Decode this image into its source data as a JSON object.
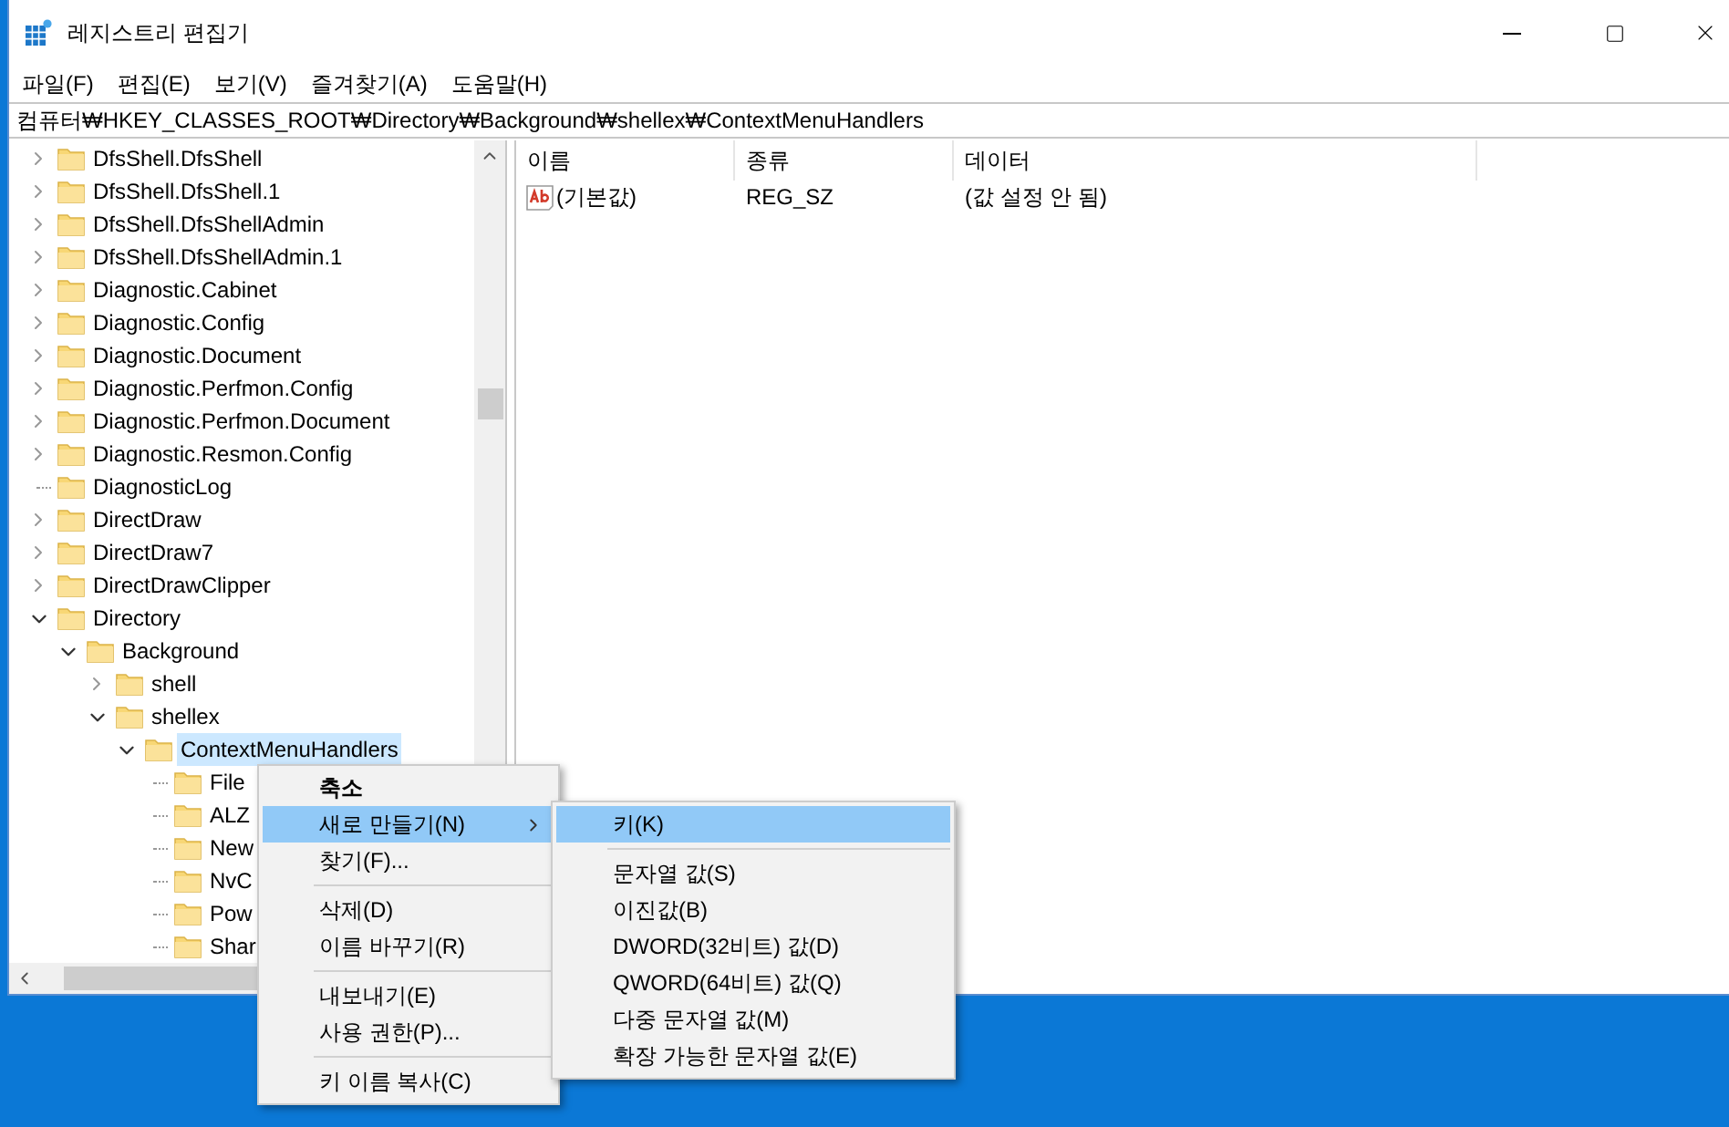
{
  "window": {
    "title": "레지스트리 편집기"
  },
  "menu_bar": [
    "파일(F)",
    "편집(E)",
    "보기(V)",
    "즐겨찾기(A)",
    "도움말(H)"
  ],
  "address": "컴퓨터₩HKEY_CLASSES_ROOT₩Directory₩Background₩shellex₩ContextMenuHandlers",
  "tree": [
    {
      "label": "DfsShell.DfsShell",
      "kind": "branch",
      "expanded": false,
      "selected": false
    },
    {
      "label": "DfsShell.DfsShell.1",
      "kind": "branch",
      "expanded": false,
      "selected": false
    },
    {
      "label": "DfsShell.DfsShellAdmin",
      "kind": "branch",
      "expanded": false,
      "selected": false
    },
    {
      "label": "DfsShell.DfsShellAdmin.1",
      "kind": "branch",
      "expanded": false,
      "selected": false
    },
    {
      "label": "Diagnostic.Cabinet",
      "kind": "branch",
      "expanded": false,
      "selected": false
    },
    {
      "label": "Diagnostic.Config",
      "kind": "branch",
      "expanded": false,
      "selected": false
    },
    {
      "label": "Diagnostic.Document",
      "kind": "branch",
      "expanded": false,
      "selected": false
    },
    {
      "label": "Diagnostic.Perfmon.Config",
      "kind": "branch",
      "expanded": false,
      "selected": false
    },
    {
      "label": "Diagnostic.Perfmon.Document",
      "kind": "branch",
      "expanded": false,
      "selected": false
    },
    {
      "label": "Diagnostic.Resmon.Config",
      "kind": "branch",
      "expanded": false,
      "selected": false
    },
    {
      "label": "DiagnosticLog",
      "kind": "leaf",
      "selected": false
    },
    {
      "label": "DirectDraw",
      "kind": "branch",
      "expanded": false,
      "selected": false
    },
    {
      "label": "DirectDraw7",
      "kind": "branch",
      "expanded": false,
      "selected": false
    },
    {
      "label": "DirectDrawClipper",
      "kind": "branch",
      "expanded": false,
      "selected": false
    },
    {
      "label": "Directory",
      "kind": "branch",
      "expanded": true,
      "selected": false,
      "children": [
        {
          "label": "Background",
          "kind": "branch",
          "expanded": true,
          "selected": false,
          "children": [
            {
              "label": "shell",
              "kind": "branch",
              "expanded": false,
              "selected": false
            },
            {
              "label": "shellex",
              "kind": "branch",
              "expanded": true,
              "selected": false,
              "children": [
                {
                  "label": "ContextMenuHandlers",
                  "kind": "branch",
                  "expanded": true,
                  "selected": true,
                  "children": [
                    {
                      "label": "File",
                      "kind": "leaf",
                      "selected": false
                    },
                    {
                      "label": "ALZ",
                      "kind": "leaf",
                      "selected": false
                    },
                    {
                      "label": "New",
                      "kind": "leaf",
                      "selected": false
                    },
                    {
                      "label": "NvC",
                      "kind": "leaf",
                      "selected": false
                    },
                    {
                      "label": "Pow",
                      "kind": "leaf",
                      "selected": false
                    },
                    {
                      "label": "Shar",
                      "kind": "leaf",
                      "selected": false
                    }
                  ]
                }
              ]
            }
          ]
        }
      ]
    }
  ],
  "list": {
    "columns": [
      "이름",
      "종류",
      "데이터"
    ],
    "rows": [
      {
        "name": "(기본값)",
        "type": "REG_SZ",
        "data": "(값 설정 안 됨)"
      }
    ]
  },
  "context_menu": [
    {
      "kind": "item",
      "label": "축소",
      "bold": true,
      "selected": false,
      "has_submenu": false
    },
    {
      "kind": "item",
      "label": "새로 만들기(N)",
      "bold": false,
      "selected": true,
      "has_submenu": true
    },
    {
      "kind": "item",
      "label": "찾기(F)...",
      "bold": false,
      "selected": false,
      "has_submenu": false
    },
    {
      "kind": "separator"
    },
    {
      "kind": "item",
      "label": "삭제(D)",
      "bold": false,
      "selected": false,
      "has_submenu": false
    },
    {
      "kind": "item",
      "label": "이름 바꾸기(R)",
      "bold": false,
      "selected": false,
      "has_submenu": false
    },
    {
      "kind": "separator"
    },
    {
      "kind": "item",
      "label": "내보내기(E)",
      "bold": false,
      "selected": false,
      "has_submenu": false
    },
    {
      "kind": "item",
      "label": "사용 권한(P)...",
      "bold": false,
      "selected": false,
      "has_submenu": false
    },
    {
      "kind": "separator"
    },
    {
      "kind": "item",
      "label": "키 이름 복사(C)",
      "bold": false,
      "selected": false,
      "has_submenu": false
    }
  ],
  "submenu": [
    {
      "kind": "item",
      "label": "키(K)",
      "bold": false,
      "selected": true,
      "has_submenu": false
    },
    {
      "kind": "separator"
    },
    {
      "kind": "item",
      "label": "문자열 값(S)",
      "bold": false,
      "selected": false,
      "has_submenu": false
    },
    {
      "kind": "item",
      "label": "이진값(B)",
      "bold": false,
      "selected": false,
      "has_submenu": false
    },
    {
      "kind": "item",
      "label": "DWORD(32비트) 값(D)",
      "bold": false,
      "selected": false,
      "has_submenu": false
    },
    {
      "kind": "item",
      "label": "QWORD(64비트) 값(Q)",
      "bold": false,
      "selected": false,
      "has_submenu": false
    },
    {
      "kind": "item",
      "label": "다중 문자열 값(M)",
      "bold": false,
      "selected": false,
      "has_submenu": false
    },
    {
      "kind": "item",
      "label": "확장 가능한 문자열 값(E)",
      "bold": false,
      "selected": false,
      "has_submenu": false
    }
  ]
}
